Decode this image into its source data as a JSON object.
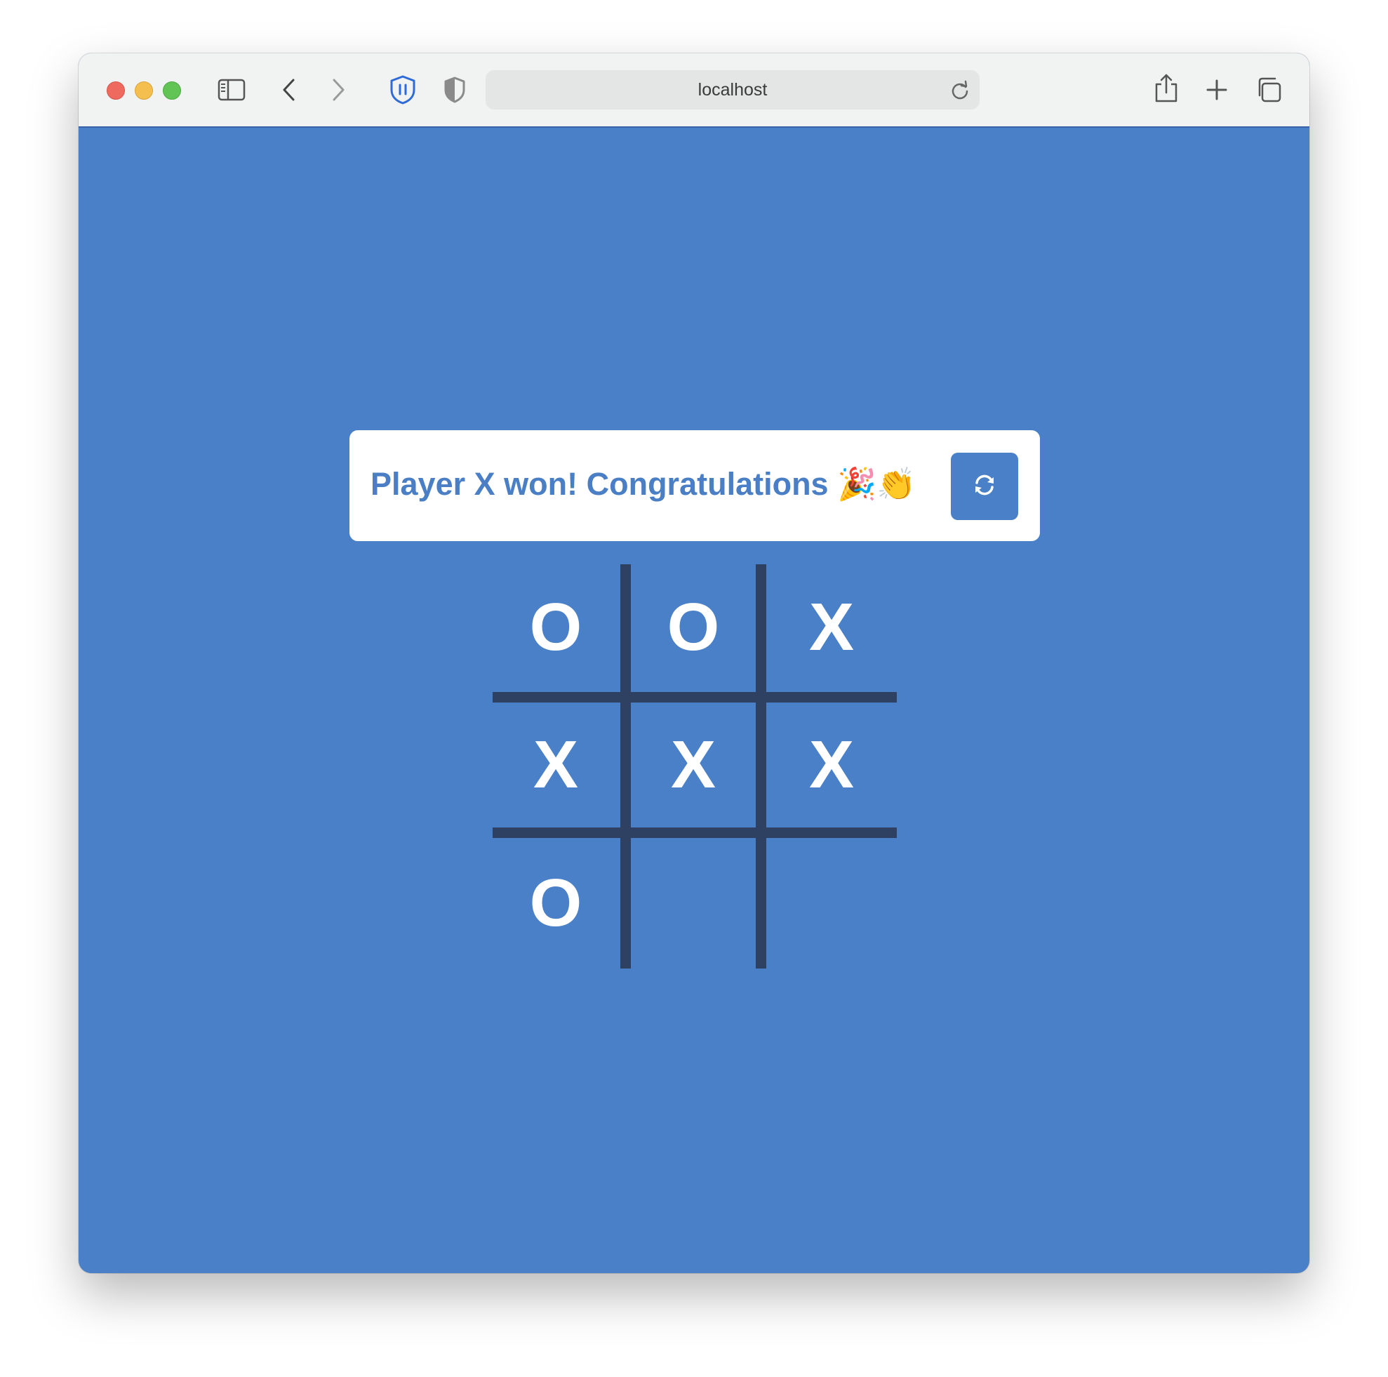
{
  "browser": {
    "url": "localhost",
    "icons": {
      "sidebar": "sidebar-icon",
      "back": "chevron-left-icon",
      "forward": "chevron-right-icon",
      "privacy": "shield-pause-icon",
      "security": "shield-half-icon",
      "reload": "reload-icon",
      "share": "share-icon",
      "new_tab": "plus-icon",
      "tabs": "tab-overview-icon"
    }
  },
  "game": {
    "status": "Player X won! Congratulations 🎉👏",
    "restart_icon": "restart-icon",
    "board": [
      "O",
      "O",
      "X",
      "X",
      "X",
      "X",
      "O",
      "",
      ""
    ]
  },
  "colors": {
    "background": "#4980c7",
    "grid": "#2e4163",
    "status_text": "#4a7fc5",
    "mark": "#ffffff"
  }
}
